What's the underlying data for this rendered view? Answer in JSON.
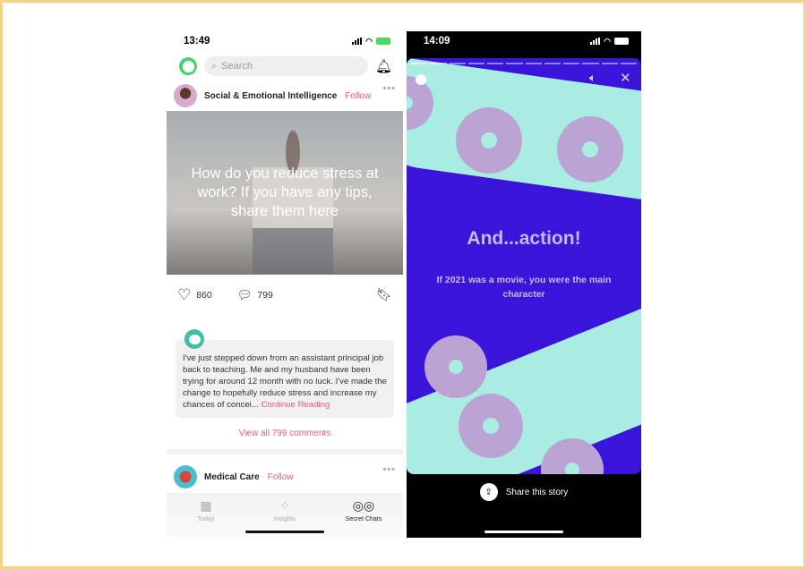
{
  "left": {
    "time": "13:49",
    "search_placeholder": "Search",
    "post1": {
      "community": "Social & Emotional Intelligence",
      "follow": "Follow",
      "question": "How do you reduce stress at work? If you have any tips, share them here",
      "likes": "860",
      "comments": "799",
      "comment_text": "I've just stepped down from an assistant principal job back to teaching. Me and my husband have been trying for around 12 month with no luck. I've made the change to hopefully reduce stress and increase my chances of concei...",
      "continue": "Continue Reading",
      "view_all": "View all 799 comments"
    },
    "post2": {
      "community": "Medical Care",
      "follow": "Follow"
    },
    "tabs": [
      {
        "label": "Today",
        "icon": "calendar-icon"
      },
      {
        "label": "Insights",
        "icon": "grid-icon"
      },
      {
        "label": "Secret Chats",
        "icon": "mask-icon"
      }
    ],
    "accent": "#ef5a7a"
  },
  "right": {
    "time": "14:09",
    "title": "And...action!",
    "subtitle": "If 2021 was a movie, you were the main character",
    "share": "Share this story",
    "segments": 12,
    "progress_first_segment": 0.4,
    "colors": {
      "bg": "#3a14d8",
      "band": "#a8ece2",
      "reel": "#bba3d3"
    }
  }
}
